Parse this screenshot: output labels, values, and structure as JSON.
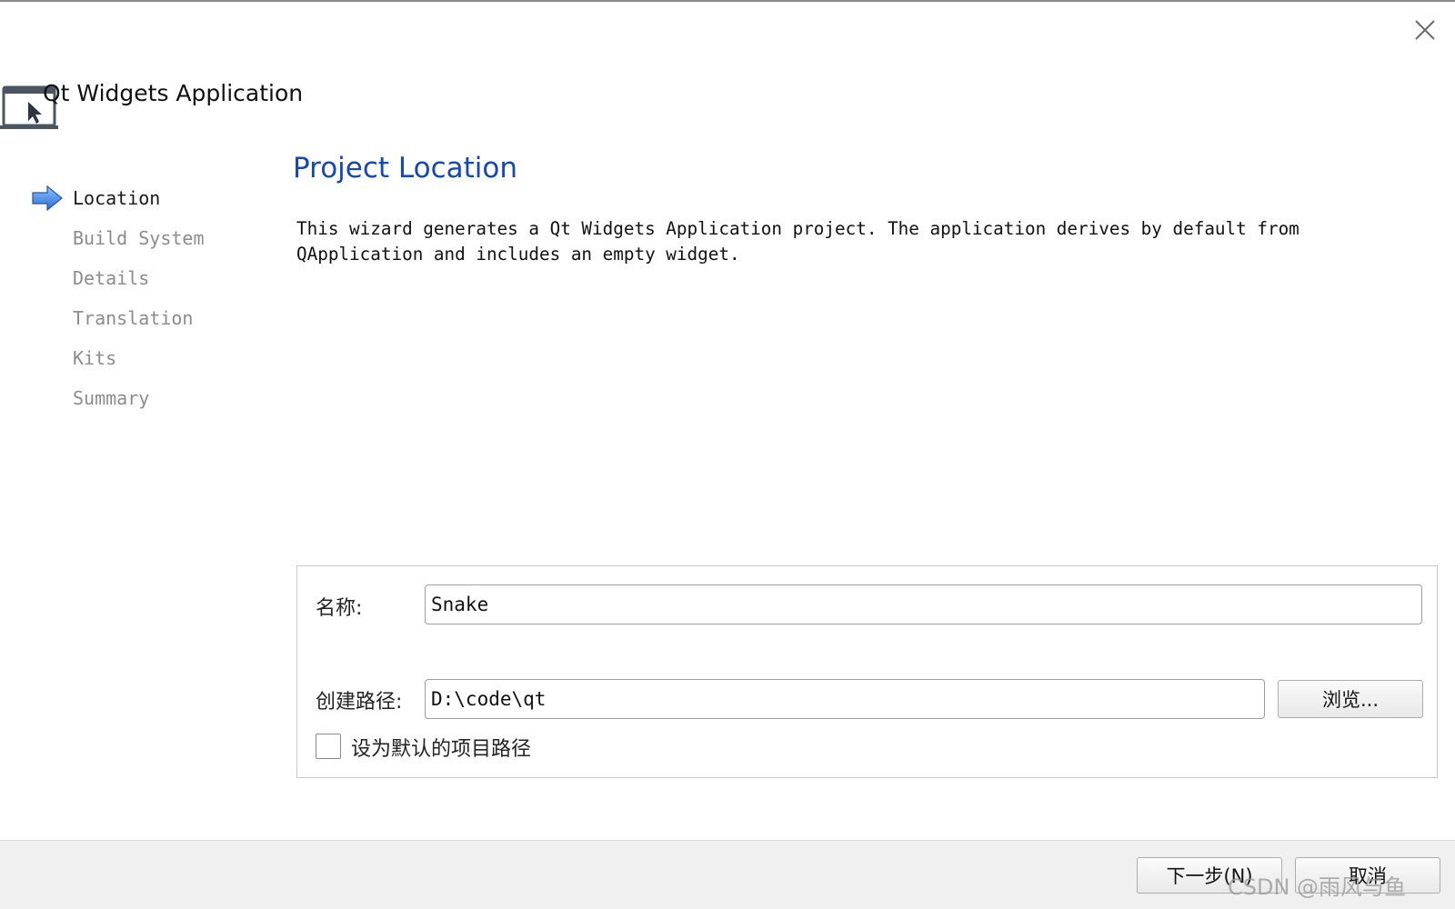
{
  "window": {
    "title": "Qt Widgets Application",
    "close_icon": "close-icon"
  },
  "steps": [
    {
      "label": "Location",
      "active": true
    },
    {
      "label": "Build System",
      "active": false
    },
    {
      "label": "Details",
      "active": false
    },
    {
      "label": "Translation",
      "active": false
    },
    {
      "label": "Kits",
      "active": false
    },
    {
      "label": "Summary",
      "active": false
    }
  ],
  "page": {
    "heading": "Project Location",
    "description_line1": "This wizard generates a Qt Widgets Application project. The application derives by default from",
    "description_line2": "QApplication and includes an empty widget."
  },
  "form": {
    "name_label": "名称:",
    "name_value": "Snake",
    "path_label": "创建路径:",
    "path_value": "D:\\code\\qt",
    "browse_label": "浏览...",
    "default_path_label": "设为默认的项目路径",
    "default_path_checked": false
  },
  "footer": {
    "next_label": "下一步(N)",
    "cancel_label": "取消"
  },
  "watermark": "CSDN @雨风与鱼",
  "colors": {
    "heading": "#1448b8",
    "inactive_step": "#8c8c8c",
    "arrow": "#3d7fe0"
  }
}
